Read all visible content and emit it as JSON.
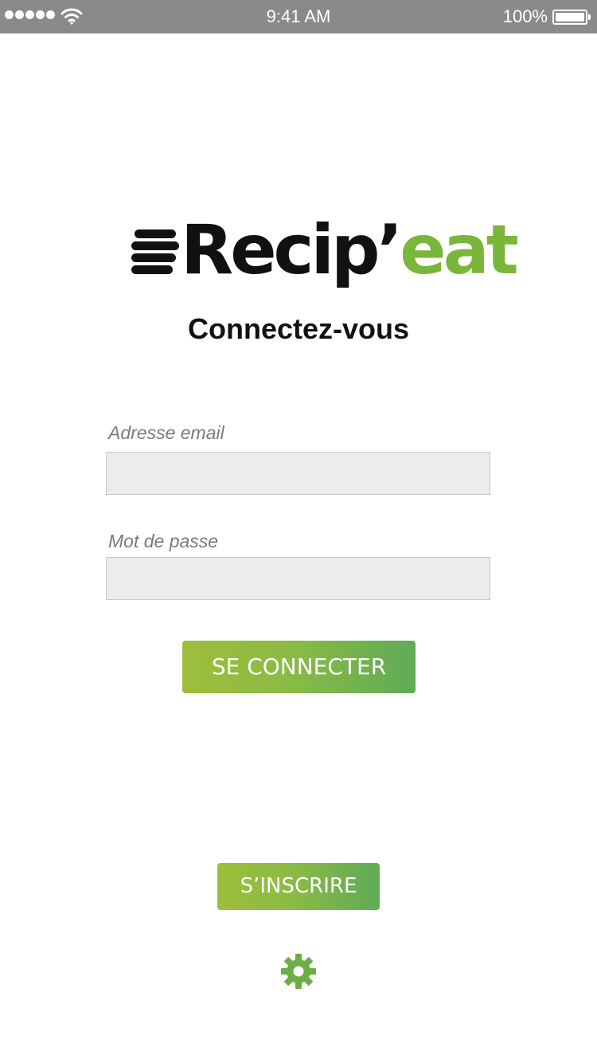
{
  "status_bar": {
    "time": "9:41 AM",
    "battery_percent": "100%",
    "signal_icon": "signal-dots-icon",
    "wifi_icon": "wifi-icon",
    "battery_icon": "battery-icon"
  },
  "logo": {
    "text_dark": "Recip’",
    "text_green": "eat",
    "icon": "logo-bars-icon"
  },
  "page_title": "Connectez-vous",
  "form": {
    "email_label": "Adresse email",
    "email_value": "",
    "password_label": "Mot de passe",
    "password_value": "",
    "login_button": "SE CONNECTER"
  },
  "signup_button": "S’INSCRIRE",
  "settings_icon": "gear-icon",
  "colors": {
    "accent_green": "#7ab63a",
    "button_gradient_start": "#9dbe3b",
    "button_gradient_end": "#5fab57",
    "status_bar": "#8a8a8a"
  }
}
